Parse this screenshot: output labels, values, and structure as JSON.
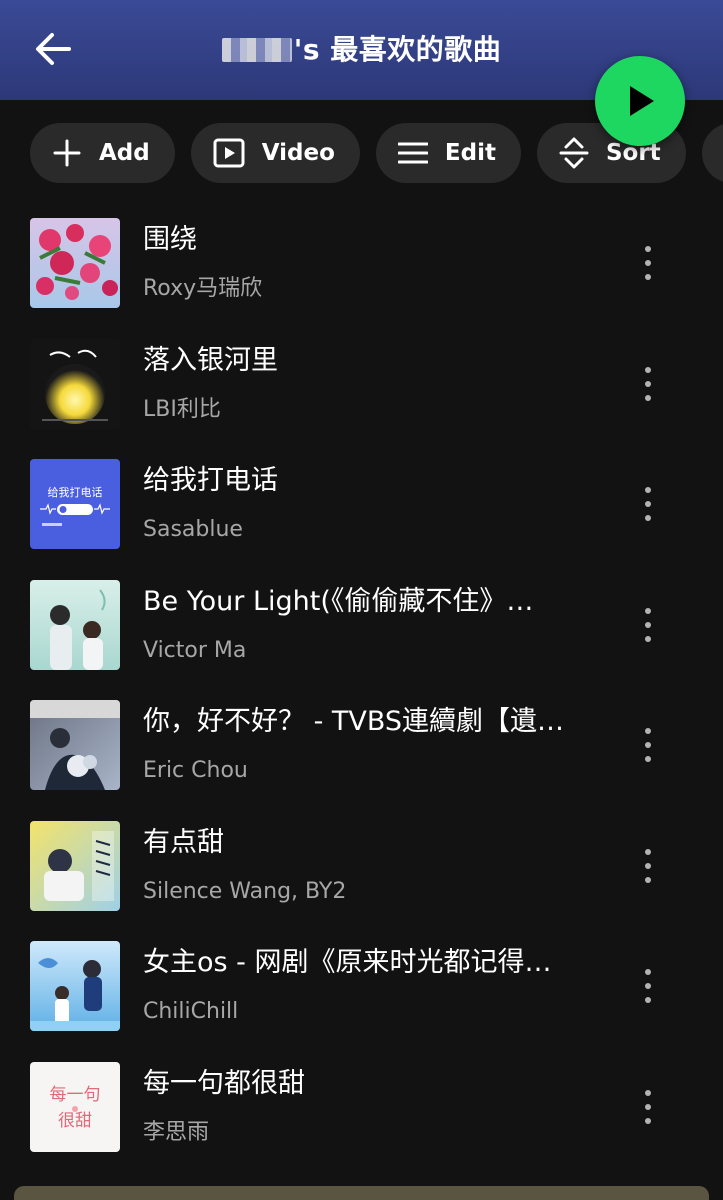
{
  "header": {
    "title": "'s 最喜欢的歌曲",
    "back_icon": "arrow-left-icon"
  },
  "actions": {
    "add_label": "Add",
    "video_label": "Video",
    "edit_label": "Edit",
    "sort_label": "Sort"
  },
  "colors": {
    "accent": "#1ed760",
    "header": "#3b4a96",
    "background": "#121212",
    "chip": "#2a2a2a",
    "secondary_text": "#a7a7a7"
  },
  "songs": [
    {
      "title": "围绕",
      "artist": "Roxy马瑞欣"
    },
    {
      "title": "落入银河里",
      "artist": "LBI利比"
    },
    {
      "title": "给我打电话",
      "artist": "Sasablue"
    },
    {
      "title": "Be Your Light(《偷偷藏不住》…",
      "artist": "Victor Ma"
    },
    {
      "title": "你，好不好？ - TVBS連續劇【遺…",
      "artist": "Eric Chou"
    },
    {
      "title": "有点甜",
      "artist": "Silence Wang, BY2"
    },
    {
      "title": "女主os - 网剧《原来时光都记得…",
      "artist": "ChiliChill"
    },
    {
      "title": "每一句都很甜",
      "artist": "李思雨"
    }
  ],
  "covers": {
    "c3_text": "给我打电话",
    "c8_text_a": "每一句",
    "c8_text_b": "很甜"
  }
}
